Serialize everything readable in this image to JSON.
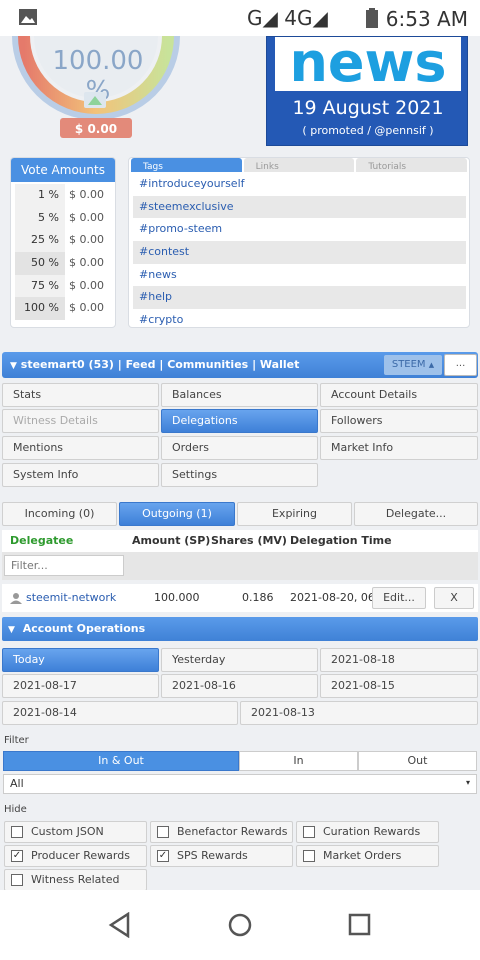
{
  "status_bar": {
    "network": "G◢ 4G◢",
    "time": "6:53 AM"
  },
  "gauge": {
    "percent": "100.00 %",
    "value": "$ 0.00"
  },
  "news_banner": {
    "word": "news",
    "date": "19 August 2021",
    "promoted": "( promoted / @pennsif )"
  },
  "vote_amounts": {
    "title": "Vote Amounts",
    "rows": [
      {
        "pct": "1 %",
        "val": "$ 0.00"
      },
      {
        "pct": "5 %",
        "val": "$ 0.00"
      },
      {
        "pct": "25 %",
        "val": "$ 0.00"
      },
      {
        "pct": "50 %",
        "val": "$ 0.00"
      },
      {
        "pct": "75 %",
        "val": "$ 0.00"
      },
      {
        "pct": "100 %",
        "val": "$ 0.00"
      }
    ]
  },
  "tags": {
    "tabs": [
      "Tags",
      "Links",
      "Tutorials"
    ],
    "items": [
      "#introduceyourself",
      "#steemexclusive",
      "#promo-steem",
      "#contest",
      "#news",
      "#help",
      "#crypto"
    ]
  },
  "user_bar": {
    "user": "steemart0 (53)",
    "links": [
      "Feed",
      "Communities",
      "Wallet"
    ],
    "chain": "STEEM",
    "more": "..."
  },
  "menu": {
    "items": [
      "Stats",
      "Balances",
      "Account Details",
      "Witness Details",
      "Delegations",
      "Followers",
      "Mentions",
      "Orders",
      "Market Info",
      "System Info",
      "Settings"
    ]
  },
  "delegation_tabs": [
    "Incoming (0)",
    "Outgoing (1)",
    "Expiring",
    "Delegate..."
  ],
  "delegation_table": {
    "headers": [
      "Delegatee",
      "Amount (SP)",
      "Shares (MV)",
      "Delegation Time"
    ],
    "filter_placeholder": "Filter...",
    "rows": [
      {
        "delegatee": "steemit-network",
        "amount": "100.000",
        "shares": "0.186",
        "time": "2021-08-20, 06",
        "edit": "Edit...",
        "remove": "X"
      }
    ]
  },
  "account_ops": {
    "title": "Account Operations",
    "dates": [
      "Today",
      "Yesterday",
      "2021-08-18",
      "2021-08-17",
      "2021-08-16",
      "2021-08-15",
      "2021-08-14",
      "2021-08-13"
    ],
    "filter_label": "Filter",
    "direction": [
      "In & Out",
      "In",
      "Out"
    ],
    "type_select": "All",
    "hide_label": "Hide",
    "hide_options": [
      {
        "label": "Custom JSON",
        "checked": false
      },
      {
        "label": "Benefactor Rewards",
        "checked": false
      },
      {
        "label": "Curation Rewards",
        "checked": false
      },
      {
        "label": "Producer Rewards",
        "checked": true
      },
      {
        "label": "SPS Rewards",
        "checked": true
      },
      {
        "label": "Market Orders",
        "checked": false
      },
      {
        "label": "Witness Related",
        "checked": false
      }
    ]
  },
  "colors": {
    "accent": "#4a90e2",
    "banner": "#2459b5",
    "news_text": "#1d9fe0"
  }
}
